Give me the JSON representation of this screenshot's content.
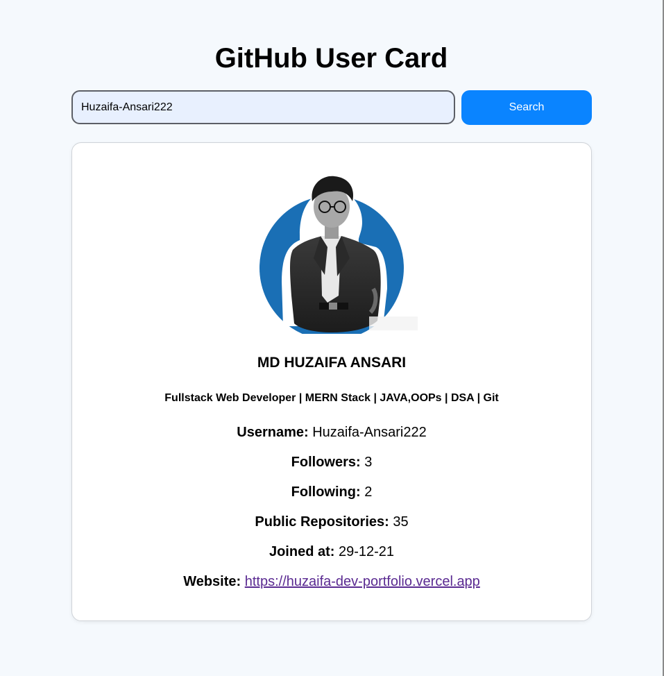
{
  "page": {
    "title": "GitHub User Card"
  },
  "search": {
    "value": "Huzaifa-Ansari222",
    "button_label": "Search"
  },
  "profile": {
    "avatar_icon": "user-avatar-photo",
    "name": "MD HUZAIFA ANSARI",
    "bio": "Fullstack Web Developer | MERN Stack | JAVA,OOPs | DSA | Git",
    "username_label": "Username:",
    "username": "Huzaifa-Ansari222",
    "followers_label": "Followers:",
    "followers": "3",
    "following_label": "Following:",
    "following": "2",
    "repos_label": "Public Repositories:",
    "repos": "35",
    "joined_label": "Joined at:",
    "joined": "29-12-21",
    "website_label": "Website:",
    "website": "https://huzaifa-dev-portfolio.vercel.app"
  },
  "colors": {
    "accent": "#0a84ff",
    "avatar_circle": "#1a6fb5",
    "link": "#5a2a91"
  }
}
